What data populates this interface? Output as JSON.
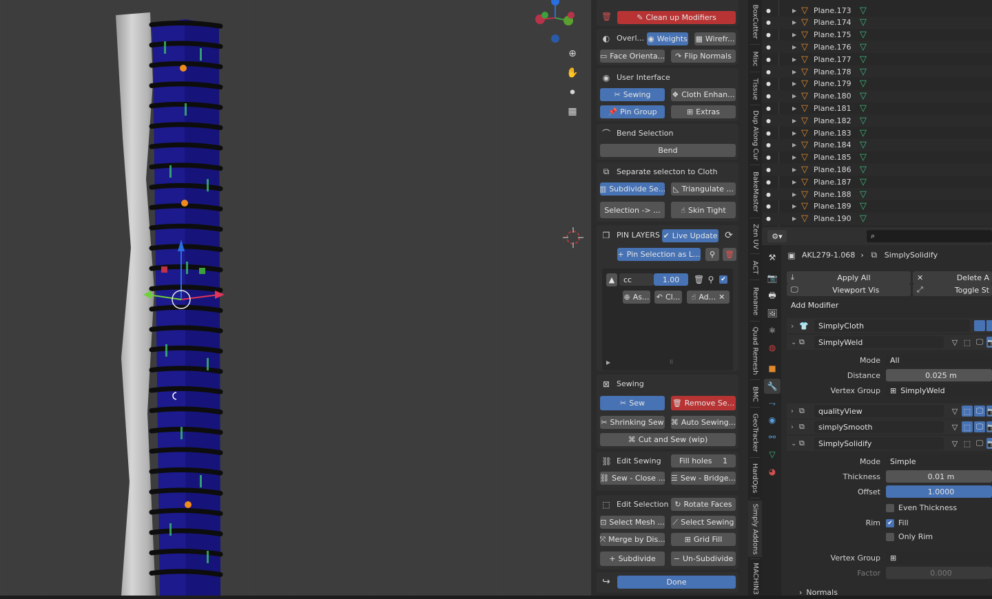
{
  "colors": {
    "accent_blue": "#4772b3",
    "danger_red": "#b83434",
    "panel_bg": "#303030",
    "viewport_bg": "#3d3d3d",
    "mesh_blue": "#1d1a8a",
    "mesh_dark": "#141414",
    "cloth_gray": "#c8c8c8",
    "vgroup_green": "#3cb878",
    "object_orange": "#e08a2c"
  },
  "icons": {
    "trash": "trash-icon",
    "eye": "eye-icon",
    "wireframe": "wireframe-icon",
    "face_orient": "face-orientation-icon",
    "flip": "flip-normals-icon",
    "sew": "sew-icon",
    "cloth": "cloth-icon",
    "pin": "pin-icon",
    "extras": "extras-icon",
    "bend": "bend-icon",
    "separate": "separate-icon",
    "subdivide": "subdivide-icon",
    "triangulate": "triangulate-icon",
    "skin": "skin-icon",
    "layers": "pin-layers-icon",
    "refresh": "refresh-icon",
    "edit_sewing": "link-icon",
    "edit_selection": "selection-icon",
    "done": "redo-icon",
    "wrench": "wrench-icon",
    "mesh": "mesh-icon"
  },
  "sidebar": {
    "top": {
      "clean_up_modifiers": "Clean up Modifiers"
    },
    "overlay": {
      "label": "Overl...",
      "weights": "Weights",
      "wireframe": "Wirefr...",
      "face_orientation": "Face Orienta...",
      "flip_normals": "Flip Normals"
    },
    "ui": {
      "title": "User Interface",
      "sewing": "Sewing",
      "cloth_enhance": "Cloth Enhan...",
      "pin_group": "Pin Group",
      "extras": "Extras"
    },
    "bend": {
      "title": "Bend Selection",
      "bend": "Bend"
    },
    "separate": {
      "title": "Separate selecton to Cloth",
      "subdivide_se": "Subdivide Se...",
      "triangulate": "Triangulate ...",
      "selection_to": "Selection -> ...",
      "skin_tight": "Skin Tight"
    },
    "pin_layers": {
      "title": "PIN LAYERS",
      "live_update": "Live Update",
      "pin_selection": "Pin Selection as L...",
      "layer_name": "cc",
      "layer_value": "1.00",
      "as": "As...",
      "cl": "Cl...",
      "ad": "Ad..."
    },
    "sewing": {
      "title": "Sewing",
      "sew": "Sew",
      "remove_sew": "Remove Se...",
      "shrinking_sew": "Shrinking Sew",
      "auto_sewing": "Auto Sewing...",
      "cut_and_sew": "Cut and Sew (wip)"
    },
    "edit_sewing": {
      "title": "Edit Sewing",
      "fill_holes": "Fill holes",
      "fill_holes_value": "1",
      "sew_close": "Sew - Close ...",
      "sew_bridge": "Sew - Bridge..."
    },
    "edit_selection": {
      "title": "Edit Selection",
      "rotate_faces": "Rotate Faces",
      "select_mesh": "Select Mesh ...",
      "select_sewing": "Select Sewing",
      "merge_by_dis": "Merge by Dis...",
      "grid_fill": "Grid Fill",
      "subdivide": "Subdivide",
      "un_subdivide": "Un-Subdivide"
    },
    "footer": {
      "done": "Done"
    }
  },
  "vtabs": [
    "BoxCutter",
    "Misc",
    "Tissue",
    "Dup Along Cur",
    "BakeMaster",
    "Zen UV",
    "ACT",
    "Rename",
    "Quad Remesh",
    "BMC",
    "GeoTracker",
    "HardOps",
    "Simply Addons",
    "MACHIN3"
  ],
  "outliner": {
    "items": [
      "Plane.173",
      "Plane.174",
      "Plane.175",
      "Plane.176",
      "Plane.177",
      "Plane.178",
      "Plane.179",
      "Plane.180",
      "Plane.181",
      "Plane.182",
      "Plane.183",
      "Plane.184",
      "Plane.185",
      "Plane.186",
      "Plane.187",
      "Plane.188",
      "Plane.189",
      "Plane.190"
    ]
  },
  "properties": {
    "breadcrumb_object": "AKL279-1.068",
    "breadcrumb_modifier": "SimplySolidify",
    "apply_all": "Apply All",
    "delete_all": "Delete A",
    "viewport_vis": "Viewport Vis",
    "toggle_stack": "Toggle St",
    "add_modifier": "Add Modifier",
    "modifiers": {
      "m1": "SimplyCloth",
      "m2": "SimplyWeld",
      "m3": "qualityView",
      "m4": "simplySmooth",
      "m5": "SimplySolidify"
    },
    "weld": {
      "mode_label": "Mode",
      "mode_value": "All",
      "distance_label": "Distance",
      "distance_value": "0.025 m",
      "vgroup_label": "Vertex Group",
      "vgroup_value": "SimplyWeld"
    },
    "solidify": {
      "mode_label": "Mode",
      "mode_value": "Simple",
      "thickness_label": "Thickness",
      "thickness_value": "0.01 m",
      "offset_label": "Offset",
      "offset_value": "1.0000",
      "offset_fraction": 1.0,
      "even_thickness": "Even Thickness",
      "rim_label": "Rim",
      "fill": "Fill",
      "only_rim": "Only Rim",
      "vgroup_label": "Vertex Group",
      "factor_label": "Factor",
      "factor_value": "0.000",
      "normals": "Normals"
    }
  }
}
